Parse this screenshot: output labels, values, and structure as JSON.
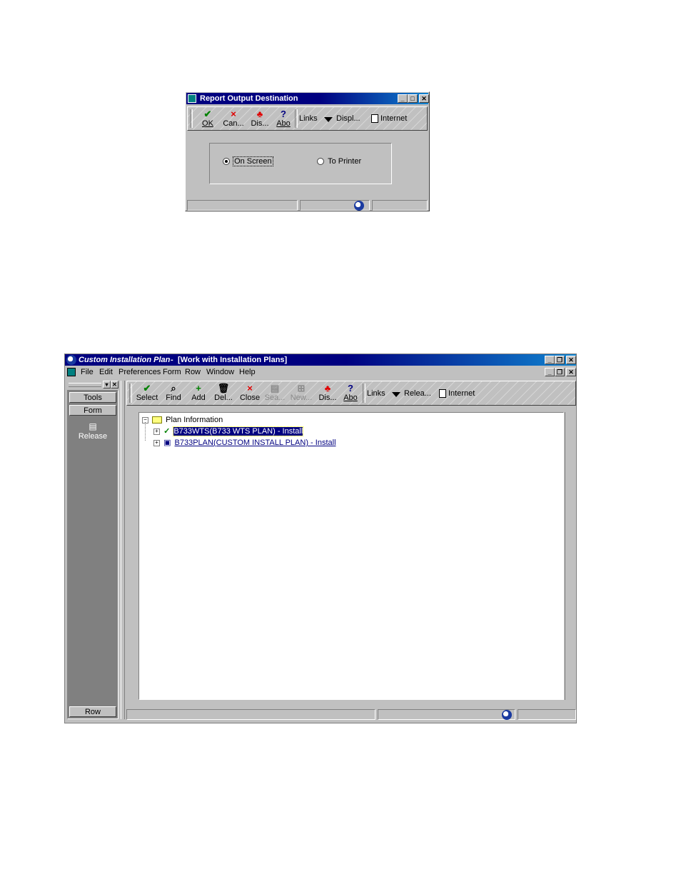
{
  "dialog": {
    "title": "Report Output Destination",
    "toolbar": {
      "ok": "OK",
      "cancel": "Can...",
      "display": "Dis...",
      "about": "Abo",
      "links": "Links",
      "display_menu": "Displ...",
      "internet": "Internet"
    },
    "options": {
      "on_screen": "On Screen",
      "to_printer": "To Printer",
      "selected": "On Screen"
    }
  },
  "main": {
    "app_title": "Custom Installation Plan",
    "form_title": "[Work with Installation Plans]",
    "title_separator": "-",
    "menu": [
      "File",
      "Edit",
      "Preferences",
      "Form",
      "Row",
      "Window",
      "Help"
    ],
    "toolbar": {
      "select": "Select",
      "find": "Find",
      "add": "Add",
      "delete": "Del...",
      "close": "Close",
      "search": "Sea...",
      "new": "New...",
      "display": "Dis...",
      "about": "Abo",
      "links": "Links",
      "release_menu": "Relea...",
      "internet": "Internet"
    },
    "sidebar": {
      "tools": "Tools",
      "form": "Form",
      "release": "Release",
      "row": "Row"
    },
    "tree": {
      "root": "Plan Information",
      "items": [
        {
          "label": "B733WTS(B733 WTS PLAN) - Install",
          "selected": true
        },
        {
          "label": "B733PLAN(CUSTOM INSTALL PLAN) - Install",
          "selected": false
        }
      ]
    }
  },
  "colors": {
    "title_active": "#000080",
    "face": "#c0c0c0",
    "sidebar_bg": "#808080",
    "link": "#000080"
  }
}
